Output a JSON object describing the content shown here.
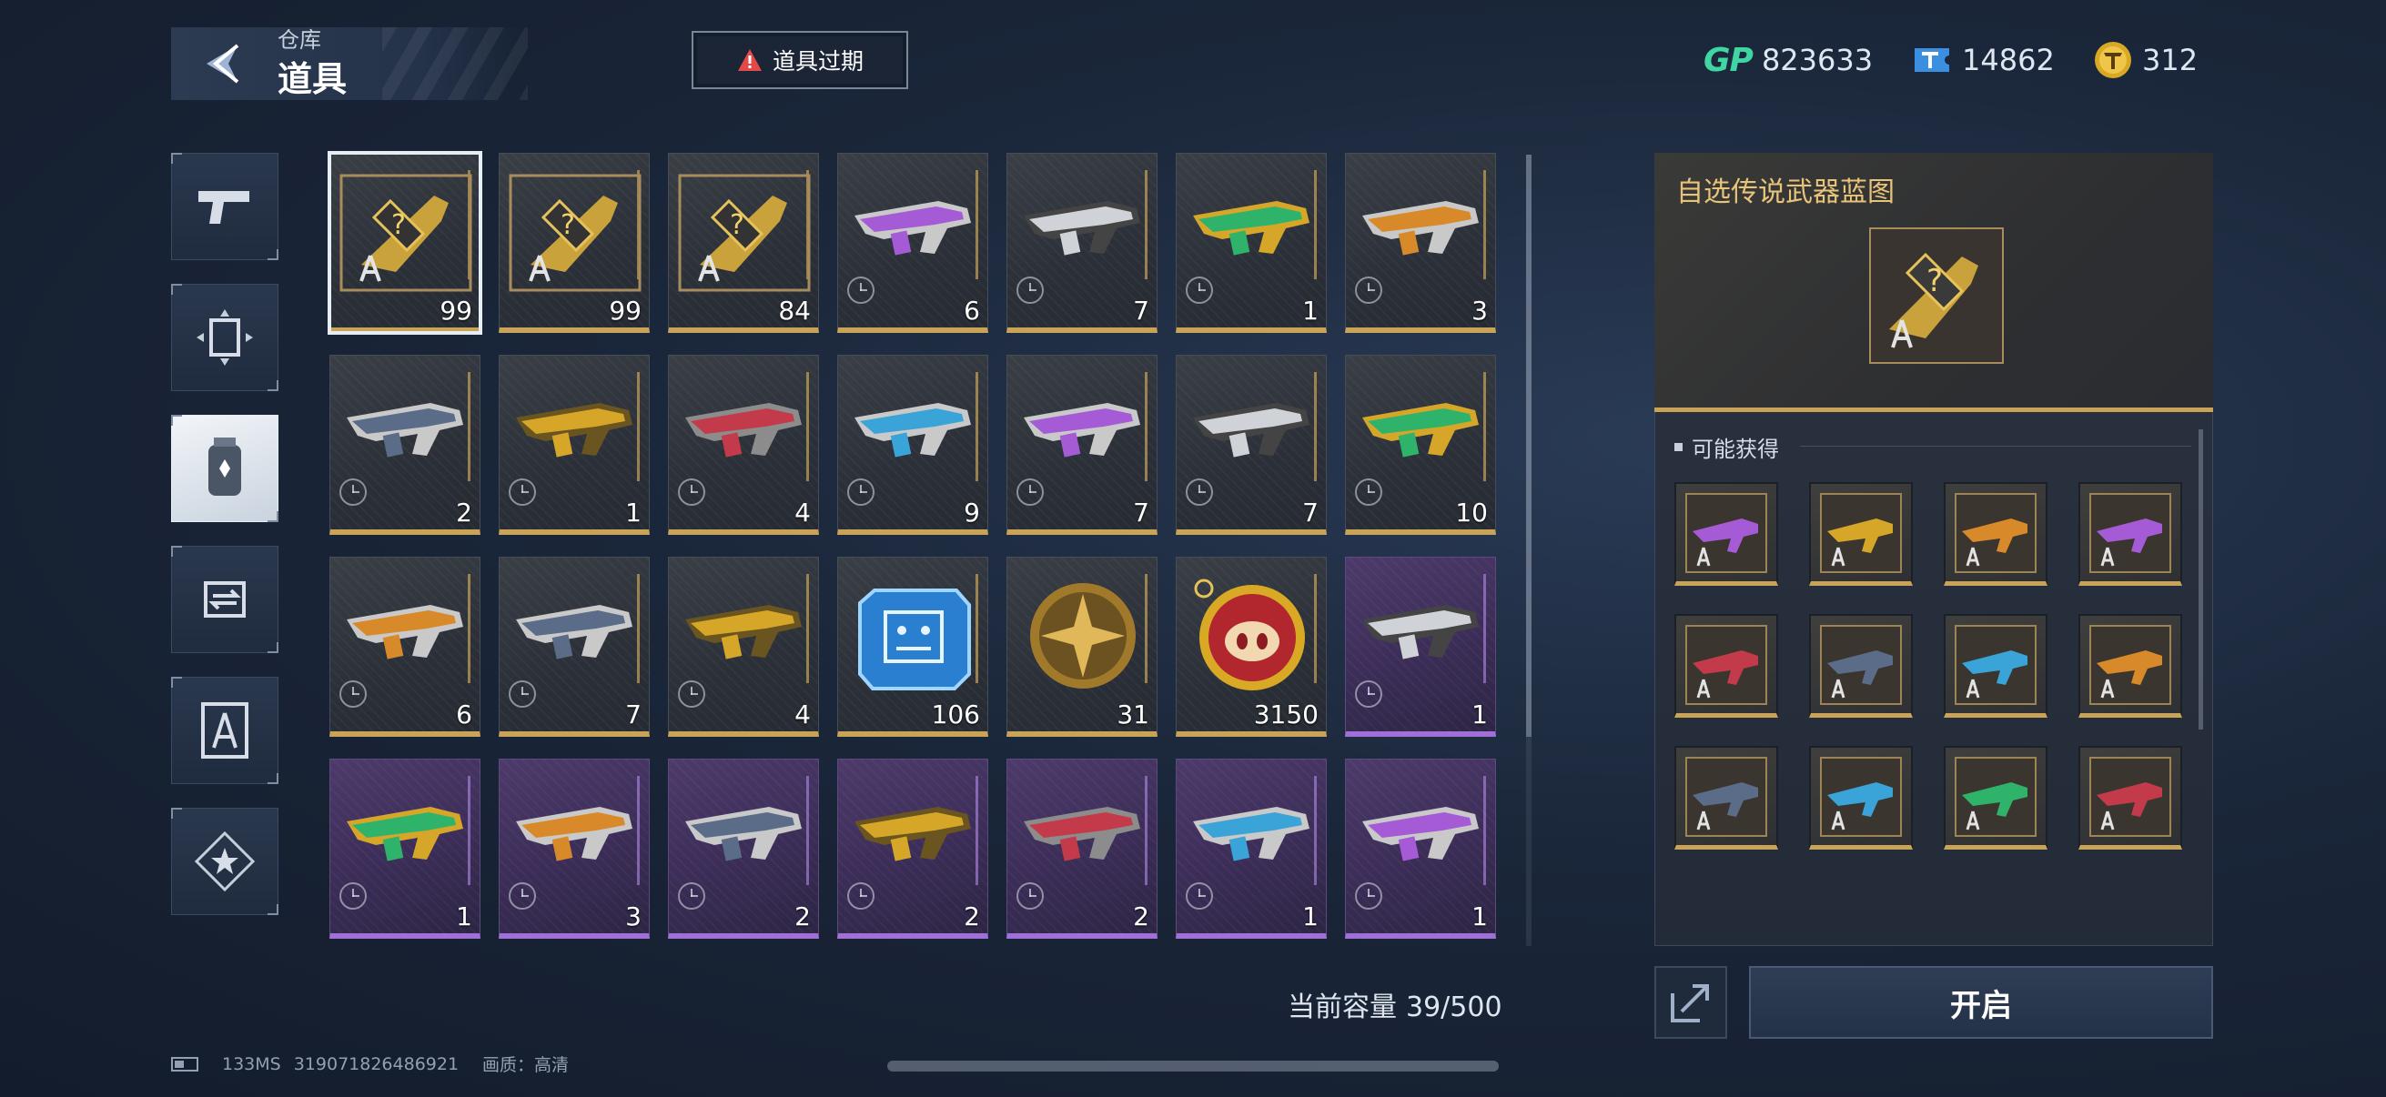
{
  "header": {
    "breadcrumb_parent": "仓库",
    "title": "道具",
    "expire_button": "道具过期"
  },
  "currencies": [
    {
      "icon": "gp-icon",
      "value": "823633"
    },
    {
      "icon": "ticket-icon",
      "value": "14862"
    },
    {
      "icon": "coin-icon",
      "value": "312"
    }
  ],
  "categories": [
    {
      "name": "pistol-icon",
      "active": false
    },
    {
      "name": "card-icon",
      "active": false
    },
    {
      "name": "canister-icon",
      "active": true
    },
    {
      "name": "exchange-icon",
      "active": false
    },
    {
      "name": "blueprint-icon",
      "active": false
    },
    {
      "name": "star-icon",
      "active": false
    }
  ],
  "items": [
    {
      "qty": "99",
      "rarity": "gold",
      "kind": "blueprint"
    },
    {
      "qty": "99",
      "rarity": "gold",
      "kind": "blueprint"
    },
    {
      "qty": "84",
      "rarity": "gold",
      "kind": "blueprint"
    },
    {
      "qty": "6",
      "rarity": "gold",
      "kind": "weapon"
    },
    {
      "qty": "7",
      "rarity": "gold",
      "kind": "weapon"
    },
    {
      "qty": "1",
      "rarity": "gold",
      "kind": "weapon"
    },
    {
      "qty": "3",
      "rarity": "gold",
      "kind": "weapon"
    },
    {
      "qty": "2",
      "rarity": "gold",
      "kind": "weapon"
    },
    {
      "qty": "1",
      "rarity": "gold",
      "kind": "weapon"
    },
    {
      "qty": "4",
      "rarity": "gold",
      "kind": "weapon"
    },
    {
      "qty": "9",
      "rarity": "gold",
      "kind": "weapon"
    },
    {
      "qty": "7",
      "rarity": "gold",
      "kind": "weapon"
    },
    {
      "qty": "7",
      "rarity": "gold",
      "kind": "weapon"
    },
    {
      "qty": "10",
      "rarity": "gold",
      "kind": "weapon"
    },
    {
      "qty": "6",
      "rarity": "gold",
      "kind": "weapon"
    },
    {
      "qty": "7",
      "rarity": "gold",
      "kind": "weapon"
    },
    {
      "qty": "4",
      "rarity": "gold",
      "kind": "weapon"
    },
    {
      "qty": "106",
      "rarity": "gold",
      "kind": "chip"
    },
    {
      "qty": "31",
      "rarity": "gold",
      "kind": "medal"
    },
    {
      "qty": "3150",
      "rarity": "gold",
      "kind": "pig-coin"
    },
    {
      "qty": "1",
      "rarity": "purple",
      "kind": "weapon"
    },
    {
      "qty": "1",
      "rarity": "purple",
      "kind": "weapon"
    },
    {
      "qty": "3",
      "rarity": "purple",
      "kind": "weapon"
    },
    {
      "qty": "2",
      "rarity": "purple",
      "kind": "weapon"
    },
    {
      "qty": "2",
      "rarity": "purple",
      "kind": "weapon"
    },
    {
      "qty": "2",
      "rarity": "purple",
      "kind": "weapon"
    },
    {
      "qty": "1",
      "rarity": "purple",
      "kind": "weapon"
    },
    {
      "qty": "1",
      "rarity": "purple",
      "kind": "weapon"
    }
  ],
  "capacity": {
    "label": "当前容量",
    "value": "39/500"
  },
  "detail": {
    "title": "自选传说武器蓝图",
    "section_label": "可能获得",
    "rewards_count": 12,
    "open_button": "开启"
  },
  "footer": {
    "ping": "133MS",
    "uid": "319071826486921",
    "quality": "画质：高清"
  },
  "colors": {
    "gold": "#c9a458",
    "purple": "#a070d8",
    "gp": "#3fd6a4",
    "title_gold": "#e8c47a"
  }
}
